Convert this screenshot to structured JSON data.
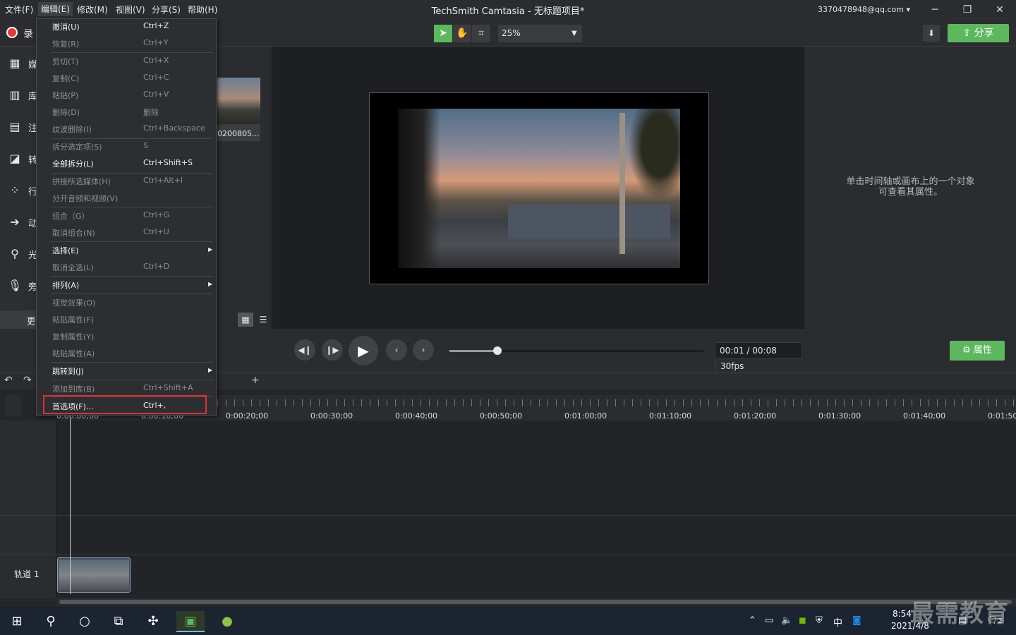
{
  "menubar": {
    "file": "文件(F)",
    "edit": "编辑(E)",
    "modify": "修改(M)",
    "view": "视图(V)",
    "share": "分享(S)",
    "help": "帮助(H)"
  },
  "window": {
    "title": "TechSmith Camtasia - 无标题项目*",
    "account": "3370478948@qq.com",
    "minimize": "─",
    "maximize": "❐",
    "close": "✕"
  },
  "toolbar": {
    "record_label": "录",
    "zoom": "25%",
    "share_label": "分享"
  },
  "sidebar": {
    "items": [
      {
        "icon": "media-icon",
        "glyph": "▦",
        "label": "媒"
      },
      {
        "icon": "library-icon",
        "glyph": "▥",
        "label": "库"
      },
      {
        "icon": "annotation-icon",
        "glyph": "▤",
        "label": "注"
      },
      {
        "icon": "transition-icon",
        "glyph": "◪",
        "label": "转"
      },
      {
        "icon": "behavior-icon",
        "glyph": "⁘",
        "label": "行"
      },
      {
        "icon": "animation-icon",
        "glyph": "➔",
        "label": "动"
      },
      {
        "icon": "cursor-effect-icon",
        "glyph": "⚲",
        "label": "光"
      },
      {
        "icon": "narration-icon",
        "glyph": "🎙",
        "label": "旁"
      }
    ],
    "more_label": "更"
  },
  "media_bin": {
    "clip_label": "0200805..."
  },
  "properties": {
    "hint_line1": "单击时间轴或画布上的一个对象",
    "hint_line2": "可查看其属性。",
    "button_label": "属性"
  },
  "playback": {
    "timecode": "00:01 / 00:08",
    "fps": "30fps",
    "progress": 0.19
  },
  "timeline": {
    "add_track": "+",
    "track_name": "轨道 1",
    "ruler": [
      "0:00:00;00",
      "0:00:10;00",
      "0:00:20;00",
      "0:00:30;00",
      "0:00:40;00",
      "0:00:50;00",
      "0:01:00;00",
      "0:01:10;00",
      "0:01:20;00",
      "0:01:30;00",
      "0:01:40;00",
      "0:01:50;"
    ]
  },
  "edit_menu": {
    "items": [
      {
        "label": "撤消(U)",
        "shortcut": "Ctrl+Z",
        "enabled": true
      },
      {
        "label": "恢复(R)",
        "shortcut": "Ctrl+Y",
        "enabled": false
      },
      {
        "label": "剪切(T)",
        "shortcut": "Ctrl+X",
        "enabled": false
      },
      {
        "label": "复制(C)",
        "shortcut": "Ctrl+C",
        "enabled": false
      },
      {
        "label": "粘贴(P)",
        "shortcut": "Ctrl+V",
        "enabled": false
      },
      {
        "label": "删除(D)",
        "shortcut": "删除",
        "enabled": false
      },
      {
        "label": "纹波删除(I)",
        "shortcut": "Ctrl+Backspace",
        "enabled": false
      },
      {
        "label": "拆分选定项(S)",
        "shortcut": "S",
        "enabled": false
      },
      {
        "label": "全部拆分(L)",
        "shortcut": "Ctrl+Shift+S",
        "enabled": true
      },
      {
        "label": "拼接所选媒体(H)",
        "shortcut": "Ctrl+Alt+I",
        "enabled": false
      },
      {
        "label": "分开音频和视频(V)",
        "shortcut": "",
        "enabled": false
      },
      {
        "label": "组合（G）",
        "shortcut": "Ctrl+G",
        "enabled": false
      },
      {
        "label": "取消组合(N)",
        "shortcut": "Ctrl+U",
        "enabled": false
      },
      {
        "label": "选择(E)",
        "shortcut": "",
        "enabled": true
      },
      {
        "label": "取消全选(L)",
        "shortcut": "Ctrl+D",
        "enabled": false
      },
      {
        "label": "排列(A)",
        "shortcut": "",
        "enabled": true
      },
      {
        "label": "视觉效果(O)",
        "shortcut": "",
        "enabled": false
      },
      {
        "label": "粘贴属性(F)",
        "shortcut": "",
        "enabled": false
      },
      {
        "label": "复制属性(Y)",
        "shortcut": "",
        "enabled": false
      },
      {
        "label": "粘贴属性(A)",
        "shortcut": "",
        "enabled": false
      },
      {
        "label": "跳转到(J)",
        "shortcut": "",
        "enabled": true
      },
      {
        "label": "添加到库(B)",
        "shortcut": "Ctrl+Shift+A",
        "enabled": false
      },
      {
        "label": "首选项(F)...",
        "shortcut": "Ctrl+,",
        "enabled": true
      }
    ]
  },
  "taskbar": {
    "time": "8:54",
    "date": "2021/4/8",
    "ime": "中",
    "notifications": "2"
  },
  "watermark": "最需教育",
  "colors": {
    "accent_green": "#5cb85c",
    "highlight_red": "#e03030"
  }
}
